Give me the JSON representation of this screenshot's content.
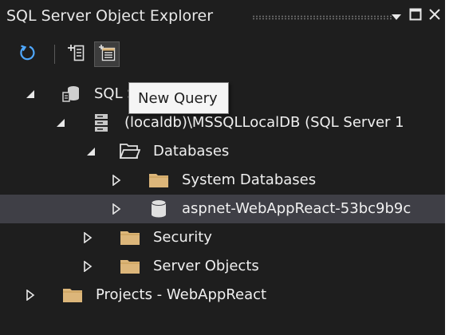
{
  "window": {
    "title": "SQL Server Object Explorer"
  },
  "toolbar": {
    "refresh_icon": "refresh-icon",
    "add_server_icon": "add-sql-server-icon",
    "new_query_icon": "new-query-icon"
  },
  "tooltip": {
    "text": "New Query"
  },
  "tree": {
    "server_root": "SQL Server",
    "instance": "(localdb)\\MSSQLLocalDB (SQL Server 1",
    "databases": "Databases",
    "system_databases": "System Databases",
    "app_database": "aspnet-WebAppReact-53bc9b9c",
    "security": "Security",
    "server_objects": "Server Objects",
    "projects": "Projects - WebAppReact"
  },
  "colors": {
    "background": "#1e1e1e",
    "selection": "#3f3f46",
    "text": "#f0f0f0",
    "folder": "#dcb67a",
    "refresh_blue": "#4fa8ff",
    "tooltip_bg": "#f5f5f5"
  }
}
